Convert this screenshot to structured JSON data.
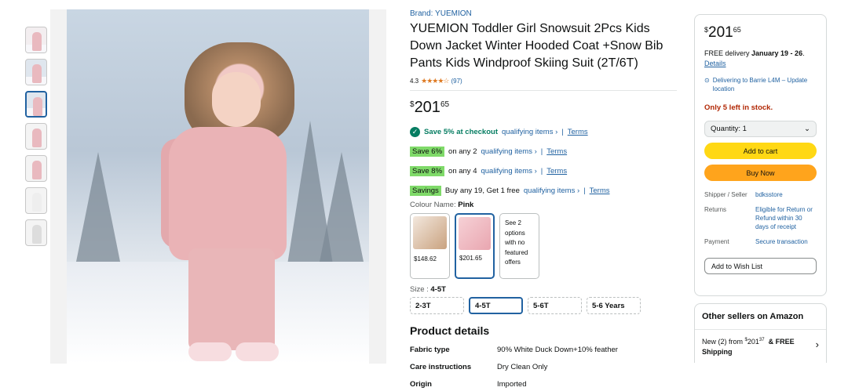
{
  "thumbnails": [
    {
      "name": "thumb-1"
    },
    {
      "name": "thumb-2"
    },
    {
      "name": "thumb-3",
      "selected": true
    },
    {
      "name": "thumb-4"
    },
    {
      "name": "thumb-5"
    },
    {
      "name": "thumb-6"
    },
    {
      "name": "thumb-7"
    }
  ],
  "product": {
    "brand": "Brand: YUEMION",
    "title": "YUEMION Toddler Girl Snowsuit 2Pcs Kids Down Jacket Winter Hooded Coat +Snow Bib Pants Kids Windproof Skiing Suit (2T/6T)",
    "rating": "4.3",
    "stars": "★★★★☆",
    "reviews": "(97)",
    "price": {
      "currency": "$",
      "whole": "201",
      "fraction": "65"
    }
  },
  "promos": [
    {
      "lead": "Save 5% at checkout",
      "link": "qualifying items ›",
      "terms": "Terms"
    },
    {
      "badge": "Save 6%",
      "text": "on any 2",
      "link": "qualifying items ›",
      "terms": "Terms"
    },
    {
      "badge": "Save 8%",
      "text": "on any 4",
      "link": "qualifying items ›",
      "terms": "Terms"
    },
    {
      "badge": "Savings",
      "text": "Buy any 19, Get 1 free",
      "link": "qualifying items ›",
      "terms": "Terms"
    }
  ],
  "colour": {
    "label": "Colour Name:",
    "value": "Pink",
    "options": [
      {
        "price": "$148.62"
      },
      {
        "price": "$201.65",
        "selected": true
      },
      {
        "text": "See 2 options with no featured offers"
      }
    ]
  },
  "size": {
    "label": "Size :",
    "value": "4-5T",
    "options": [
      "2-3T",
      "4-5T",
      "5-6T",
      "5-6 Years"
    ]
  },
  "details": {
    "title": "Product details",
    "rows": [
      {
        "k": "Fabric type",
        "v": "90% White Duck Down+10% feather"
      },
      {
        "k": "Care instructions",
        "v": "Dry Clean Only"
      },
      {
        "k": "Origin",
        "v": "Imported"
      }
    ]
  },
  "buybox": {
    "price": {
      "currency": "$",
      "whole": "201",
      "fraction": "65"
    },
    "delivery_prefix": "FREE delivery",
    "delivery_date": "January 19 - 26",
    "details_link": "Details",
    "location": "Delivering to Barrie L4M – Update location",
    "stock": "Only 5 left in stock.",
    "quantity": "Quantity: 1",
    "add_to_cart": "Add to cart",
    "buy_now": "Buy Now",
    "shipper_label": "Shipper / Seller",
    "shipper_value": "bdksstore",
    "returns_label": "Returns",
    "returns_value": "Eligible for Return or Refund within 30 days of receipt",
    "payment_label": "Payment",
    "payment_value": "Secure transaction",
    "wishlist": "Add to Wish List"
  },
  "others": {
    "title": "Other sellers on Amazon",
    "offer_prefix": "New (2) from",
    "offer_currency": "$",
    "offer_whole": "201",
    "offer_fraction": "37",
    "offer_suffix": "& FREE",
    "offer_shipping": "Shipping"
  },
  "colors": {
    "link": "#2162a1",
    "cart": "#ffd814",
    "buy": "#ffa41c",
    "stock": "#b12704",
    "badge": "#7fda69"
  }
}
